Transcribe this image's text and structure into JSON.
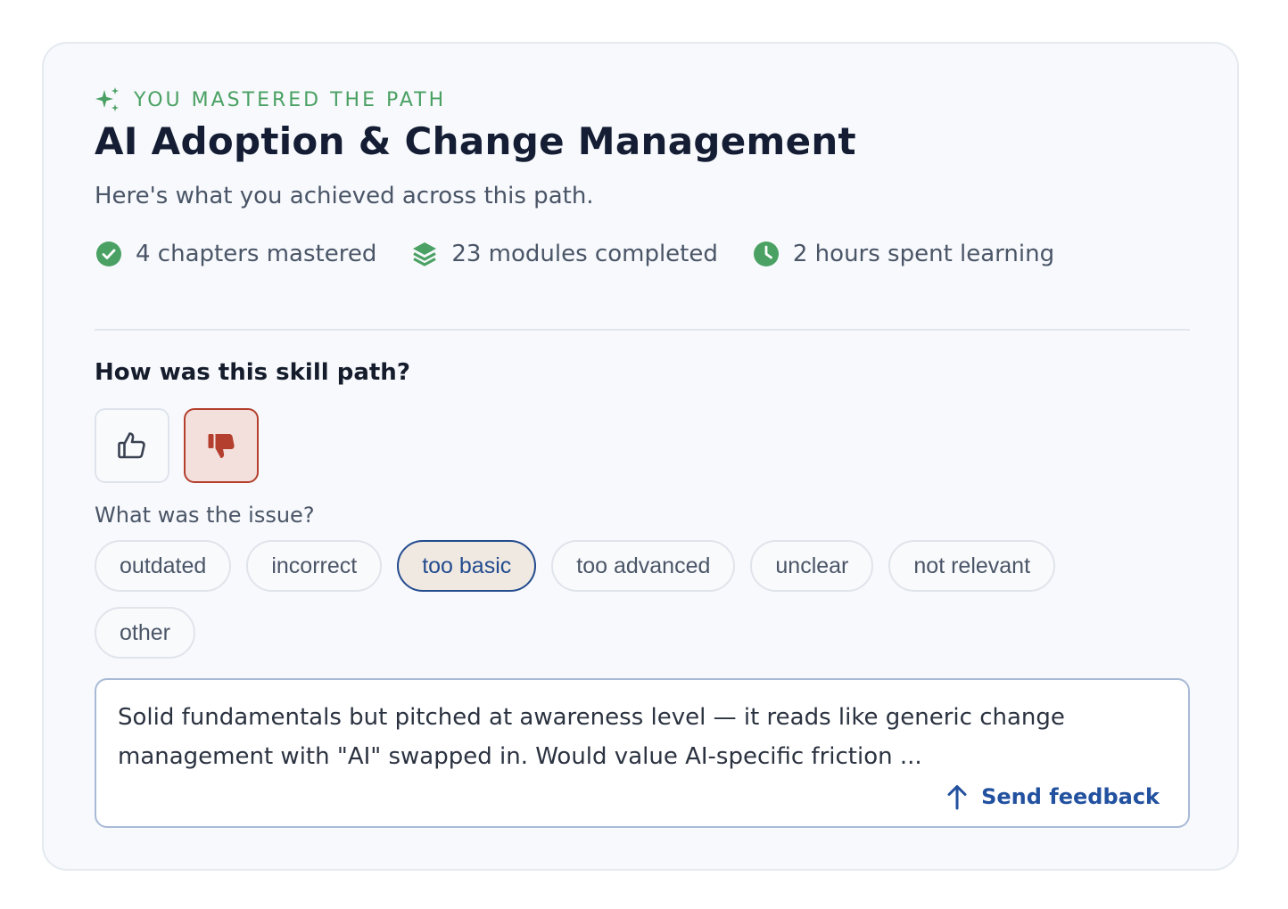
{
  "header": {
    "eyebrow": "YOU MASTERED THE PATH",
    "title": "AI Adoption & Change Management",
    "subtitle": "Here's what you achieved across this path."
  },
  "stats": [
    {
      "icon": "check-circle-icon",
      "label": "4 chapters mastered"
    },
    {
      "icon": "layers-icon",
      "label": "23 modules completed"
    },
    {
      "icon": "clock-icon",
      "label": "2 hours spent learning"
    }
  ],
  "rating": {
    "question": "How was this skill path?",
    "selected": "thumbs-down"
  },
  "issues": {
    "label": "What was the issue?",
    "options": [
      "outdated",
      "incorrect",
      "too basic",
      "too advanced",
      "unclear",
      "not relevant",
      "other"
    ],
    "selected": "too basic"
  },
  "feedback": {
    "text": "Solid fundamentals but pitched at awareness level — it reads like generic change management with \"AI\" swapped in. Would value AI-specific friction ...",
    "send_label": "Send feedback"
  },
  "colors": {
    "accent_green": "#4aa163",
    "negative_red": "#b43f2e",
    "link_blue": "#22519f"
  }
}
